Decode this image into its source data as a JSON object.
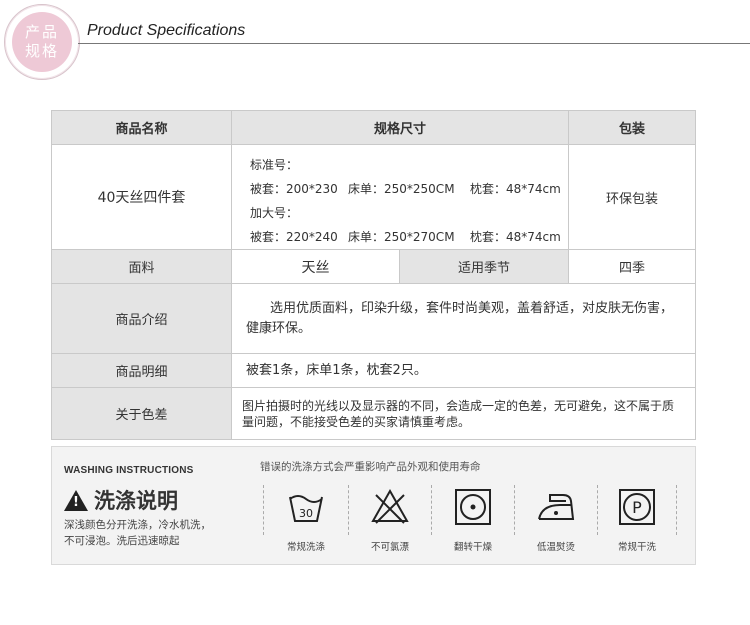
{
  "header": {
    "badge_line1": "产品",
    "badge_line2": "规格",
    "title": "Product Specifications"
  },
  "table": {
    "headers": [
      "商品名称",
      "规格尺寸",
      "包装"
    ],
    "product_name": "40天丝四件套",
    "sizes": {
      "standard_label": "标准号：",
      "standard_duvet": "被套：200*230",
      "standard_sheet": "床单：250*250CM",
      "standard_pillow": "枕套：48*74cm",
      "large_label": "加大号：",
      "large_duvet": "被套：220*240",
      "large_sheet": "床单：250*270CM",
      "large_pillow": "枕套：48*74cm"
    },
    "packaging": "环保包装",
    "fabric_label": "面料",
    "fabric_value": "天丝",
    "season_label": "适用季节",
    "season_value": "四季",
    "intro_label": "商品介绍",
    "intro_value": "选用优质面料，印染升级，套件时尚美观，盖着舒适，对皮肤无伤害，健康环保。",
    "detail_label": "商品明细",
    "detail_value": "被套1条，床单1条，枕套2只。",
    "color_label": "关于色差",
    "color_value": "图片拍摄时的光线以及显示器的不同，会造成一定的色差，无可避免，这不属于质量问题，不能接受色差的买家请慎重考虑。"
  },
  "washing": {
    "heading_en": "WASHING INSTRUCTIONS",
    "heading_cn": "洗涤说明",
    "top_note": "错误的洗涤方式会严重影响产品外观和使用寿命",
    "desc_line1": "深浅颜色分开洗涤，冷水机洗，",
    "desc_line2": "不可浸泡。洗后迅速晾起",
    "icons": [
      {
        "name": "wash-30-icon",
        "label": "常规洗涤",
        "mark": "30"
      },
      {
        "name": "no-bleach-icon",
        "label": "不可氯漂"
      },
      {
        "name": "tumble-dry-icon",
        "label": "翻转干燥"
      },
      {
        "name": "low-iron-icon",
        "label": "低温熨烫"
      },
      {
        "name": "dry-clean-p-icon",
        "label": "常规干洗",
        "mark": "P"
      }
    ]
  }
}
